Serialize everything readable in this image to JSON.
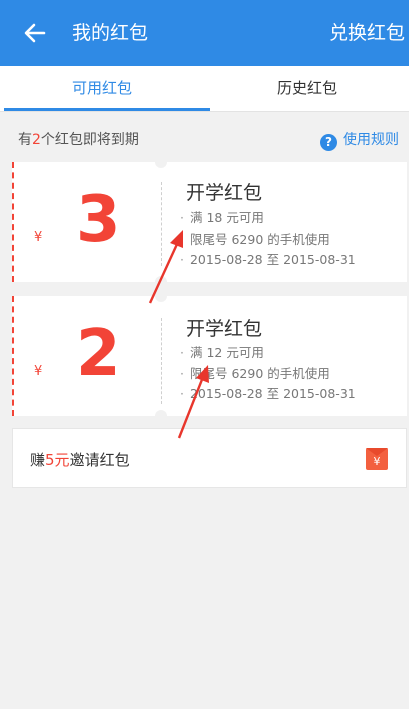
{
  "header": {
    "title": "我的红包",
    "action": "兑换红包",
    "back_icon": "arrow-left-icon"
  },
  "tabs": [
    {
      "label": "可用红包",
      "active": true
    },
    {
      "label": "历史红包",
      "active": false
    }
  ],
  "notice": {
    "prefix": "有",
    "count": "2",
    "suffix": "个红包即将到期"
  },
  "rules": {
    "label": "使用规则",
    "icon": "question-circle-icon"
  },
  "coupons": [
    {
      "currency": "¥",
      "amount": "3",
      "title": "开学红包",
      "line1": "满 18 元可用",
      "line2": "限尾号 6290 的手机使用",
      "line3": "2015-08-28 至 2015-08-31"
    },
    {
      "currency": "¥",
      "amount": "2",
      "title": "开学红包",
      "line1": "满 12 元可用",
      "line2": "限尾号 6290 的手机使用",
      "line3": "2015-08-28 至 2015-08-31"
    }
  ],
  "invite": {
    "prefix": "赚",
    "amount": "5元",
    "suffix": "邀请红包",
    "icon": "red-envelope-icon",
    "icon_glyph": "¥"
  },
  "colors": {
    "primary": "#2f8ae5",
    "accent": "#f24437",
    "background": "#f1f1f1"
  }
}
